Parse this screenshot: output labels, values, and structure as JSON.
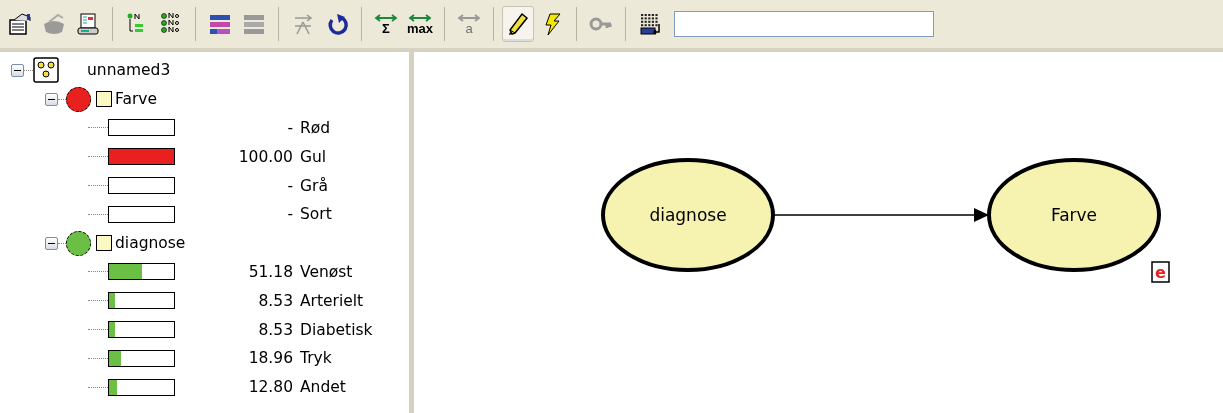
{
  "toolbar": {
    "buttons": [
      {
        "kind": "properties",
        "disabled": false,
        "pressed": false
      },
      {
        "kind": "database",
        "disabled": true,
        "pressed": false
      },
      {
        "kind": "print",
        "disabled": false,
        "pressed": false
      },
      {
        "kind": "sep"
      },
      {
        "kind": "node-tree",
        "disabled": false,
        "pressed": false
      },
      {
        "kind": "node-list",
        "disabled": false,
        "pressed": false
      },
      {
        "kind": "sep"
      },
      {
        "kind": "bars",
        "disabled": false,
        "pressed": false
      },
      {
        "kind": "bars",
        "disabled": true,
        "pressed": false
      },
      {
        "kind": "sep"
      },
      {
        "kind": "arrows",
        "disabled": true,
        "pressed": false
      },
      {
        "kind": "reset",
        "disabled": false,
        "pressed": false
      },
      {
        "kind": "sep"
      },
      {
        "kind": "propagate",
        "glyph": "Σ",
        "disabled": false,
        "pressed": false
      },
      {
        "kind": "propagate",
        "glyph": "max",
        "disabled": false,
        "pressed": false
      },
      {
        "kind": "sep"
      },
      {
        "kind": "propagate",
        "glyph": "a",
        "disabled": true,
        "pressed": false
      },
      {
        "kind": "sep"
      },
      {
        "kind": "pencil",
        "disabled": false,
        "pressed": true
      },
      {
        "kind": "lightning",
        "disabled": false,
        "pressed": false
      },
      {
        "kind": "sep"
      },
      {
        "kind": "key",
        "disabled": true,
        "pressed": false
      },
      {
        "kind": "sep"
      },
      {
        "kind": "table",
        "disabled": false,
        "pressed": false
      }
    ]
  },
  "tree": {
    "label": "unnamed3",
    "expanded": true,
    "children": [
      {
        "label": "Farve",
        "color": "#e82020",
        "expanded": true,
        "states": [
          {
            "probability": "-",
            "state": "Rød",
            "level": 0
          },
          {
            "probability": "100.00",
            "state": "Gul",
            "level": 1
          },
          {
            "probability": "-",
            "state": "Grå",
            "level": 0
          },
          {
            "probability": "-",
            "state": "Sort",
            "level": 0
          }
        ]
      },
      {
        "label": "diagnose",
        "color": "#6cbf45",
        "expanded": true,
        "states": [
          {
            "probability": "51.18",
            "state": "Venøst",
            "level": 0.5118
          },
          {
            "probability": "8.53",
            "state": "Arterielt",
            "level": 0.0853
          },
          {
            "probability": "8.53",
            "state": "Diabetisk",
            "level": 0.0853
          },
          {
            "probability": "18.96",
            "state": "Tryk",
            "level": 0.1896
          },
          {
            "probability": "12.80",
            "state": "Andet",
            "level": 0.128
          }
        ]
      }
    ]
  },
  "network": {
    "nodes": [
      {
        "label": "diagnose",
        "evidence": false
      },
      {
        "label": "Farve",
        "evidence": true,
        "badge": "e"
      }
    ]
  }
}
